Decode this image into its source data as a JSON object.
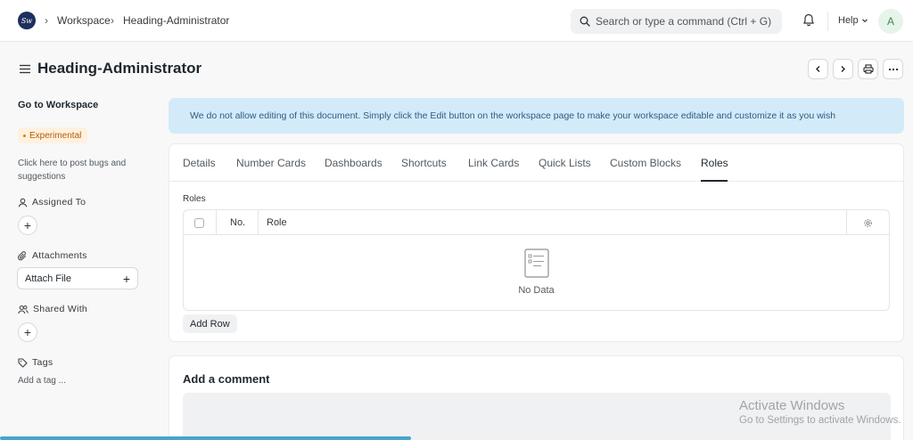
{
  "navbar": {
    "breadcrumbs": [
      "Workspace",
      "Heading-Administrator"
    ],
    "search_placeholder": "Search or type a command (Ctrl + G)",
    "help_label": "Help",
    "avatar_initial": "A"
  },
  "page": {
    "title": "Heading-Administrator"
  },
  "sidebar": {
    "go_to_workspace": "Go to Workspace",
    "badge": "Experimental",
    "note": "Click here to post bugs and suggestions",
    "assigned_to": "Assigned To",
    "attachments": "Attachments",
    "attach_file": "Attach File",
    "shared_with": "Shared With",
    "tags": "Tags",
    "add_tag": "Add a tag ..."
  },
  "alert": {
    "text": "We do not allow editing of this document. Simply click the Edit button on the workspace page to make your workspace editable and customize it as you wish"
  },
  "tabs": [
    "Details",
    "Number Cards",
    "Dashboards",
    "Shortcuts",
    "Link Cards",
    "Quick Lists",
    "Custom Blocks",
    "Roles"
  ],
  "active_tab": "Roles",
  "roles_table": {
    "label": "Roles",
    "columns": [
      "No.",
      "Role"
    ],
    "empty_text": "No Data",
    "add_row": "Add Row"
  },
  "comment": {
    "title": "Add a comment"
  },
  "watermark": {
    "title": "Activate Windows",
    "subtitle": "Go to Settings to activate Windows."
  },
  "progress": {
    "fraction": 0.45
  },
  "colors": {
    "alert_bg": "#d3eaf9",
    "alert_text": "#2d5d85",
    "badge_bg": "#fff1e0",
    "badge_text": "#b35c00",
    "progress": "#4aa3c8"
  }
}
